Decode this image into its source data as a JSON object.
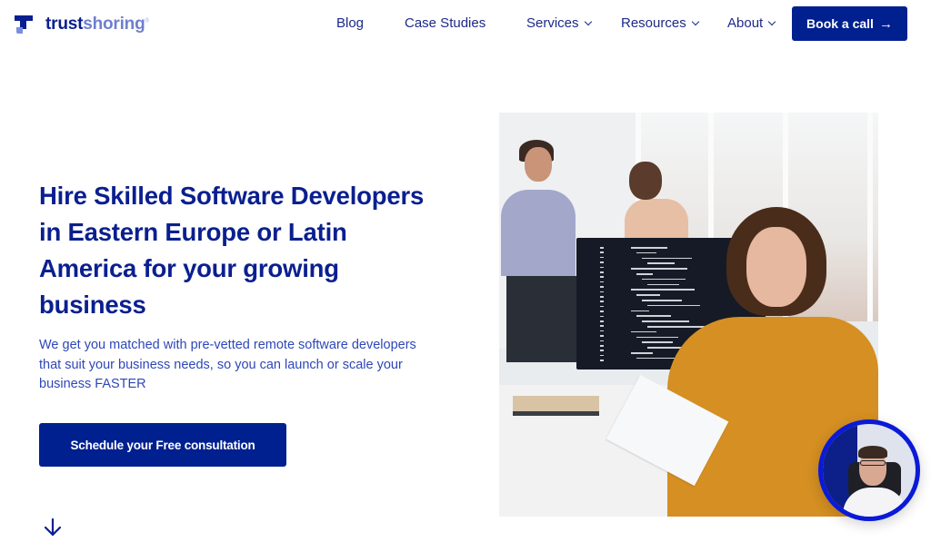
{
  "brand": {
    "name_part1": "trust",
    "name_part2": "shoring",
    "registered_mark": "®",
    "logo_icon": "trustshoring-logo-icon",
    "primary_color": "#00208f",
    "secondary_color": "#6e7fcf"
  },
  "nav": {
    "items": [
      {
        "label": "Blog",
        "has_dropdown": false
      },
      {
        "label": "Case Studies",
        "has_dropdown": false
      },
      {
        "label": "Services",
        "has_dropdown": true
      },
      {
        "label": "Resources",
        "has_dropdown": true
      },
      {
        "label": "About",
        "has_dropdown": true
      }
    ],
    "cta_label": "Book a call",
    "cta_icon": "arrow-right-icon",
    "cta_arrow": "→"
  },
  "hero": {
    "title": "Hire Skilled Software Developers in Eastern Europe or Latin America for your growing business",
    "subtitle": "We get you matched with pre-vetted remote software developers that suit your business needs, so you can launch or scale your business FASTER",
    "cta_label": "Schedule your Free consultation",
    "scroll_icon": "arrow-down-icon"
  },
  "media": {
    "hero_image": "office-developers-photo",
    "video_bubble": "presenter-video-bubble",
    "video_border_color": "#0a1ad6"
  }
}
